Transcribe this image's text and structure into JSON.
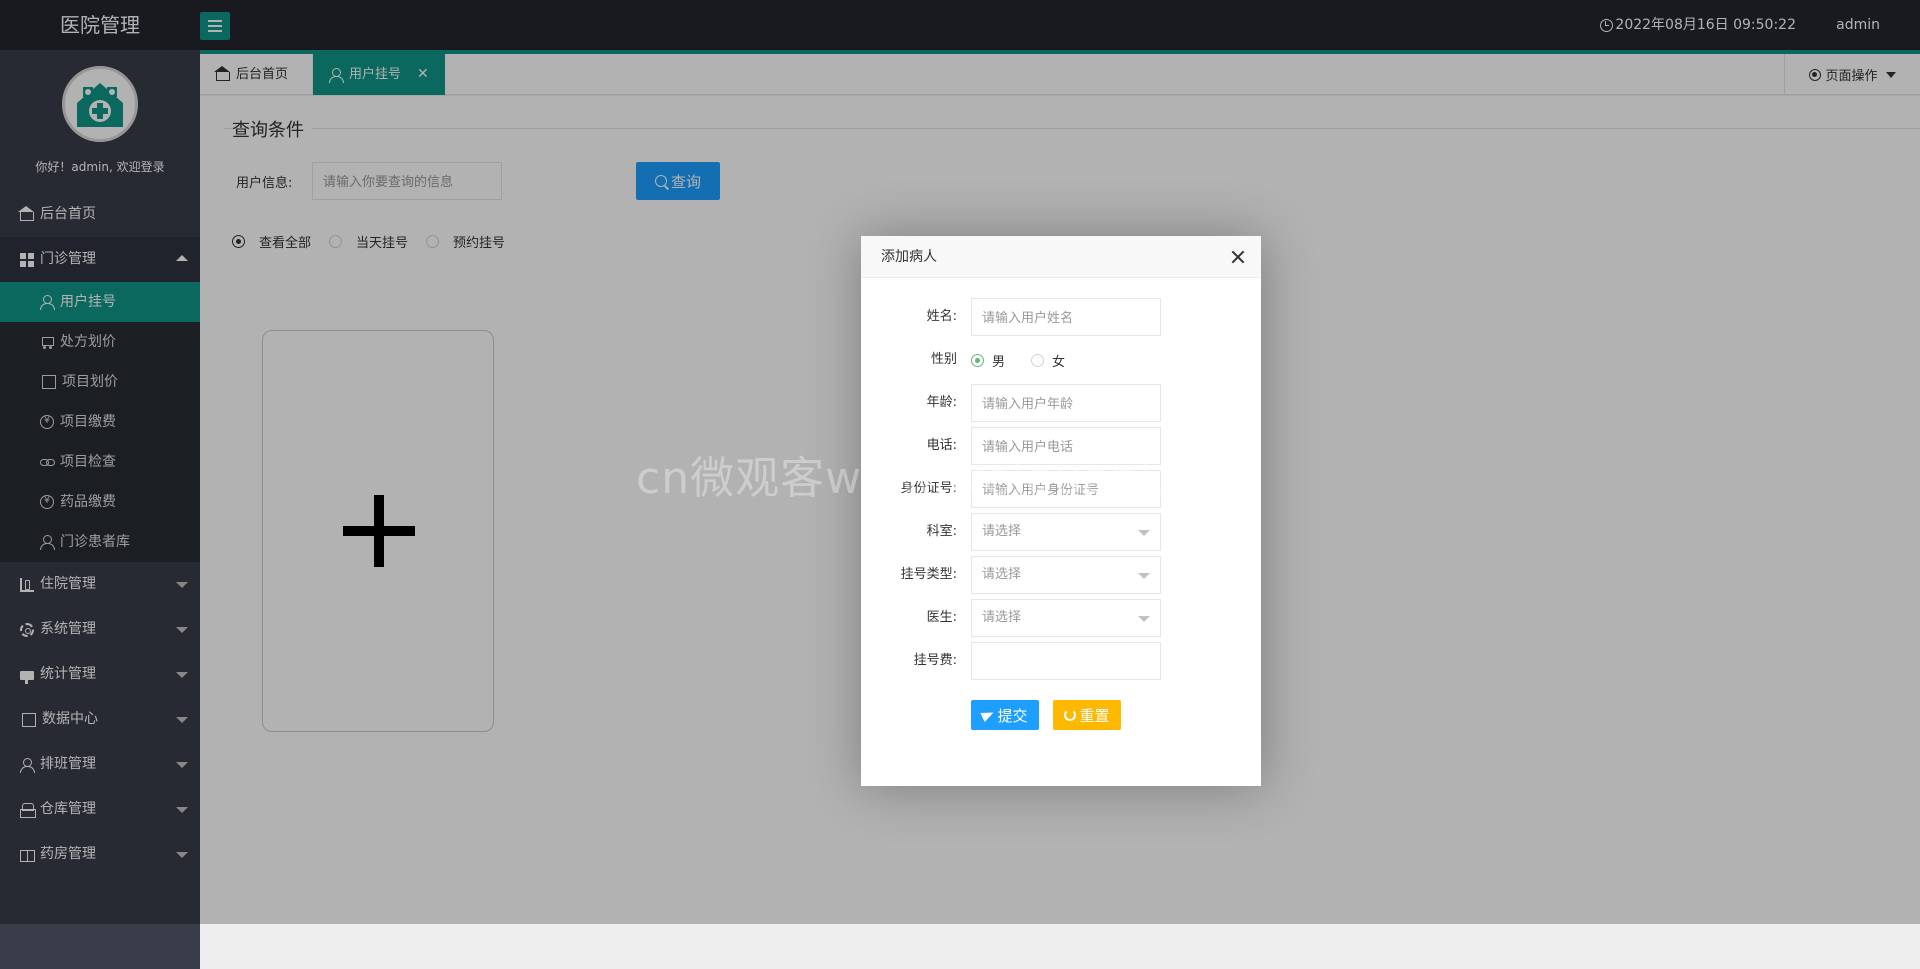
{
  "header": {
    "app_title": "医院管理",
    "datetime": "2022年08月16日 09:50:22",
    "user": "admin"
  },
  "sidebar": {
    "welcome": "你好！admin, 欢迎登录",
    "home": "后台首页",
    "outpatient": {
      "label": "门诊管理",
      "items": [
        "用户挂号",
        "处方划价",
        "项目划价",
        "项目缴费",
        "项目检查",
        "药品缴费",
        "门诊患者库"
      ]
    },
    "groups": [
      "住院管理",
      "系统管理",
      "统计管理",
      "数据中心",
      "排班管理",
      "仓库管理",
      "药房管理"
    ]
  },
  "tabs": {
    "home": "后台首页",
    "active": "用户挂号",
    "page_ops": "页面操作"
  },
  "query": {
    "legend": "查询条件",
    "label": "用户信息:",
    "placeholder": "请输入你要查询的信息",
    "button": "查询",
    "filters": [
      "查看全部",
      "当天挂号",
      "预约挂号"
    ]
  },
  "modal": {
    "title": "添加病人",
    "fields": {
      "name_label": "姓名:",
      "name_placeholder": "请输入用户姓名",
      "sex_label": "性别",
      "sex_male": "男",
      "sex_female": "女",
      "age_label": "年龄:",
      "age_placeholder": "请输入用户年龄",
      "phone_label": "电话:",
      "phone_placeholder": "请输入用户电话",
      "idcard_label": "身份证号:",
      "idcard_placeholder": "请输入用户身份证号",
      "dept_label": "科室:",
      "dept_value": "请选择",
      "regtype_label": "挂号类型:",
      "regtype_value": "请选择",
      "doctor_label": "医生:",
      "doctor_value": "请选择",
      "fee_label": "挂号费:",
      "fee_value": ""
    },
    "submit": "提交",
    "reset": "重置"
  },
  "watermark": "cn微观客www.weiguanke.cn",
  "colors": {
    "header_bg": "#23262e",
    "sidebar_bg": "#393d49",
    "accent": "#0f9688",
    "primary_btn": "#1e9fff",
    "warn_btn": "#ffb800"
  }
}
